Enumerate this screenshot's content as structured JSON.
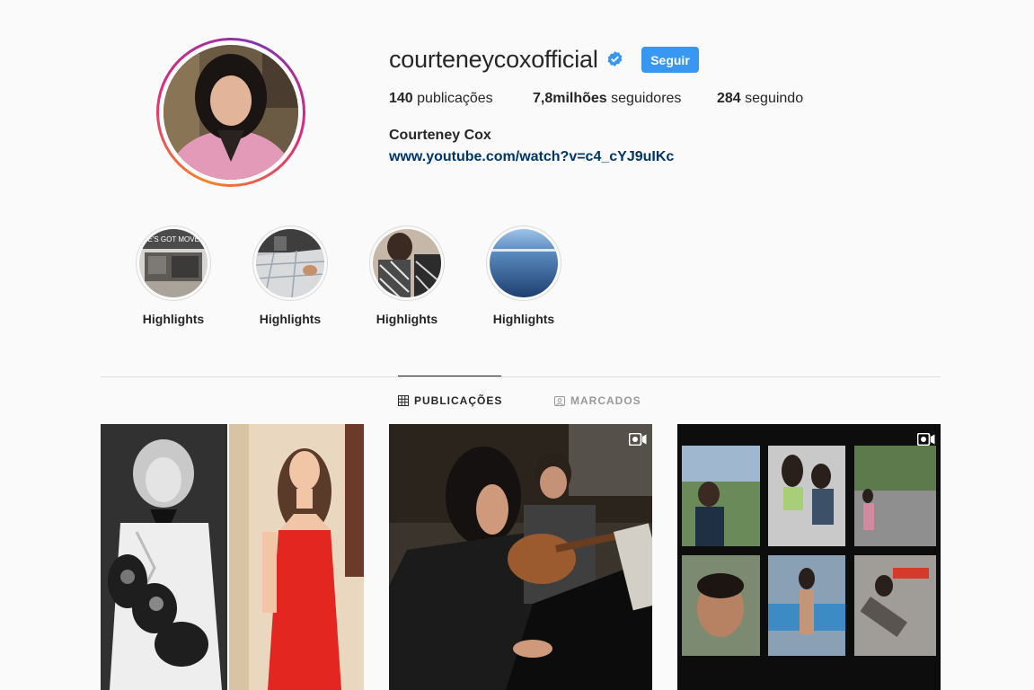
{
  "profile": {
    "username": "courteneycoxofficial",
    "verified": true,
    "follow_label": "Seguir",
    "stats": {
      "posts_count": "140",
      "posts_label": "publicações",
      "followers_count": "7,8milhões",
      "followers_label": "seguidores",
      "following_count": "284",
      "following_label": "seguindo"
    },
    "full_name": "Courteney Cox",
    "link": "www.youtube.com/watch?v=c4_cYJ9uIKc"
  },
  "highlights": [
    {
      "label": "Highlights",
      "overlay_text": "HE'S GOT MOVES"
    },
    {
      "label": "Highlights"
    },
    {
      "label": "Highlights"
    },
    {
      "label": "Highlights"
    }
  ],
  "tabs": [
    {
      "label": "PUBLICAÇÕES",
      "icon": "grid-icon",
      "active": true
    },
    {
      "label": "MARCADOS",
      "icon": "tagged-icon",
      "active": false
    }
  ],
  "posts": [
    {
      "type": "photo",
      "description": "yearbook-vs-red-dress"
    },
    {
      "type": "video",
      "icon": "video-icon"
    },
    {
      "type": "video",
      "icon": "video-icon"
    }
  ],
  "colors": {
    "accent": "#3897f0",
    "link": "#003569",
    "text": "#262626",
    "muted": "#999999",
    "border": "#dbdbdb",
    "background": "#fafafa"
  }
}
